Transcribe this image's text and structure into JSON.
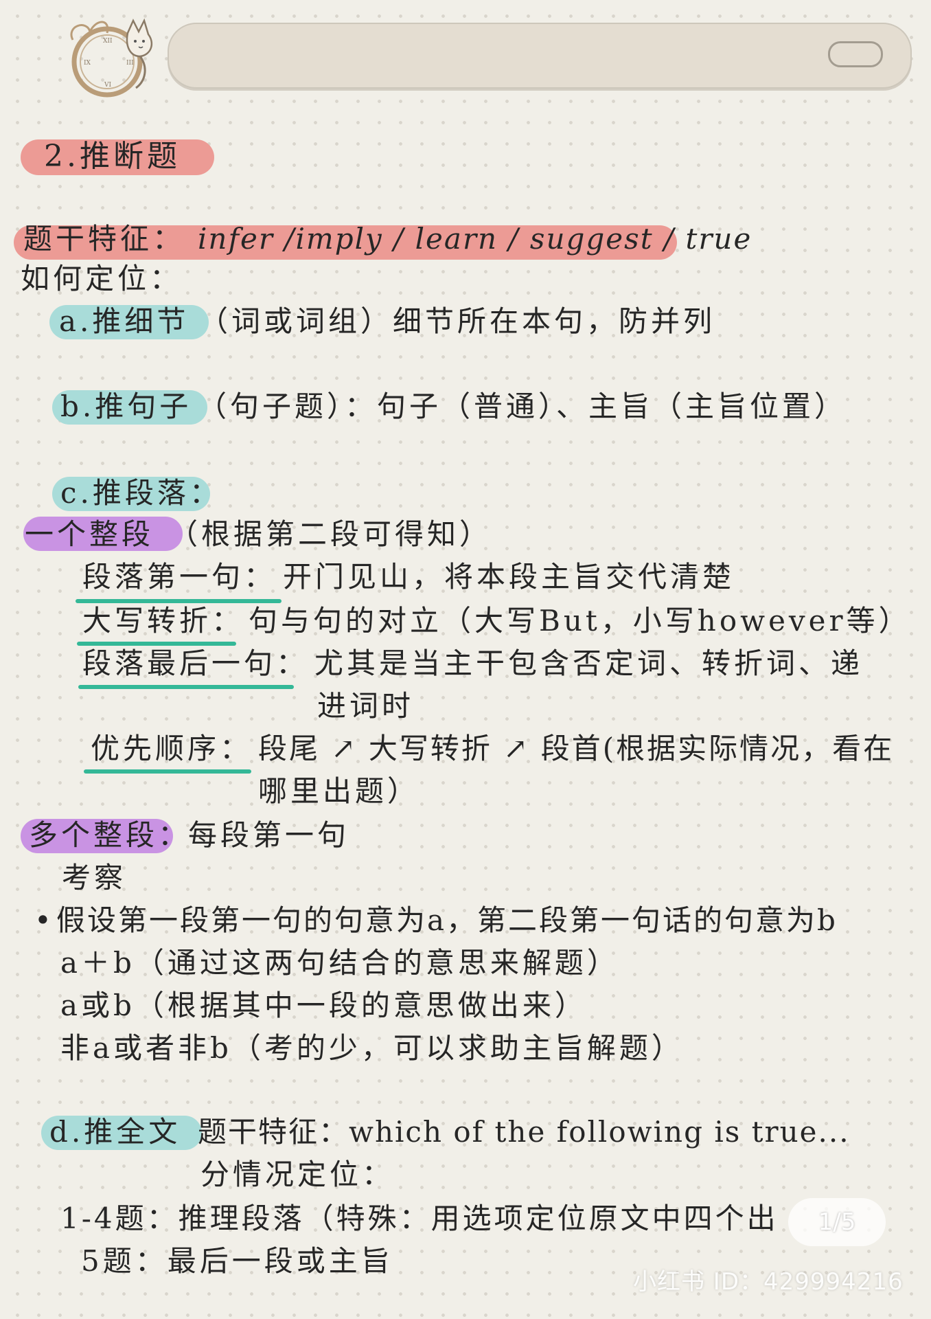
{
  "title": "2.推断题",
  "stem": {
    "label": "题干特征：",
    "keywords": "infer /imply / learn / suggest / true"
  },
  "locate_heading": "如何定位：",
  "items": {
    "a": {
      "label": "a.推细节",
      "text": "（词或词组）细节所在本句，防并列"
    },
    "b": {
      "label": "b.推句子",
      "text": "（句子题）：句子（普通）、主旨（主旨位置）"
    },
    "c": {
      "label": "c.推段落："
    }
  },
  "single_para": {
    "label": "一个整段",
    "note": "（根据第二段可得知）",
    "rules": [
      {
        "key": "段落第一句：",
        "text": "开门见山，将本段主旨交代清楚"
      },
      {
        "key": "大写转折：",
        "text": "句与句的对立（大写But，小写however等）"
      },
      {
        "key": "段落最后一句：",
        "text": "尤其是当主干包含否定词、转折词、递",
        "cont": "进词时"
      }
    ],
    "priority": {
      "key": "优先顺序：",
      "text": "段尾 ↗ 大写转折 ↗ 段首(根据实际情况，看在",
      "cont": "哪里出题）"
    }
  },
  "multi_para": {
    "label": "多个整段：",
    "text": "每段第一句",
    "exam": "考察",
    "bullet": "假设第一段第一句的句意为a，第二段第一句话的句意为b",
    "cases": [
      "a＋b（通过这两句结合的意思来解题）",
      "a或b（根据其中一段的意思做出来）",
      "非a或者非b（考的少，可以求助主旨解题）"
    ]
  },
  "item_d": {
    "label": "d.推全文",
    "stem": "题干特征：which of the following is true...",
    "sub": "分情况定位：",
    "cases": [
      "1-4题：推理段落（特殊：用选项定位原文中四个出",
      "5题：最后一段或主旨"
    ]
  },
  "page_badge": "1/5",
  "watermark": "小红书 ID：429994216",
  "colors": {
    "pink": "#ec9b95",
    "teal": "#a9dcd9",
    "purple": "#c993e3",
    "underline": "#34b897"
  }
}
